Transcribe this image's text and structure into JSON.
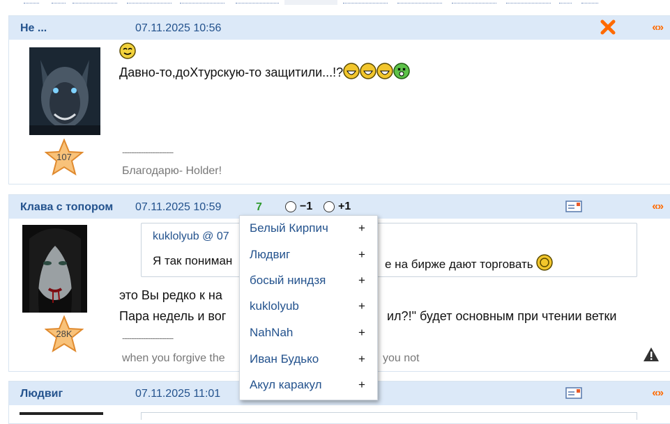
{
  "posts": [
    {
      "author": "Не ...",
      "date": "07.11.2025 10:56",
      "quote_link": "«»",
      "rank": "107",
      "message": "Давно-то,доХтурскую-то защитили...!?",
      "signature_divider": "----------------------",
      "signature": "Благодарю- Holder!"
    },
    {
      "author": "Клава с топором",
      "date": "07.11.2025 10:59",
      "quote_link": "«»",
      "rating": "7",
      "vote_minus": "−1",
      "vote_plus": "+1",
      "rank": "28K",
      "quote": {
        "author": "kuklolyub @ 07",
        "text_left": "Я так пониман",
        "text_right": "е на бирже дают торговать"
      },
      "message_line1": "это Вы редко к на",
      "message_line2_left": "Пара недель и вог",
      "message_line2_right": "ил?!\" будет основным при чтении ветки",
      "signature_divider": "----------------------",
      "signature_left": "when you forgive the",
      "signature_right": "you not"
    },
    {
      "author": "Людвиг",
      "date": "07.11.2025 11:01",
      "quote_link": "«»"
    }
  ],
  "dropdown": {
    "items": [
      {
        "name": "Белый Кирпич",
        "action": "+"
      },
      {
        "name": "Людвиг",
        "action": "+"
      },
      {
        "name": "босый ниндзя",
        "action": "+"
      },
      {
        "name": "kuklolyub",
        "action": "+"
      },
      {
        "name": "NahNah",
        "action": "+"
      },
      {
        "name": "Иван Будько",
        "action": "+"
      },
      {
        "name": "Акул каракул",
        "action": "+"
      }
    ]
  },
  "icons": {
    "close": "close-x-icon",
    "pm": "private-message-icon",
    "warn": "warning-triangle-icon",
    "star": "star-rank-icon",
    "smiley": "smiley-icon"
  },
  "colors": {
    "header_bg": "#dce9f8",
    "link": "#23528d",
    "accent": "#ff6a00",
    "rating_positive": "#2e9a2e"
  }
}
